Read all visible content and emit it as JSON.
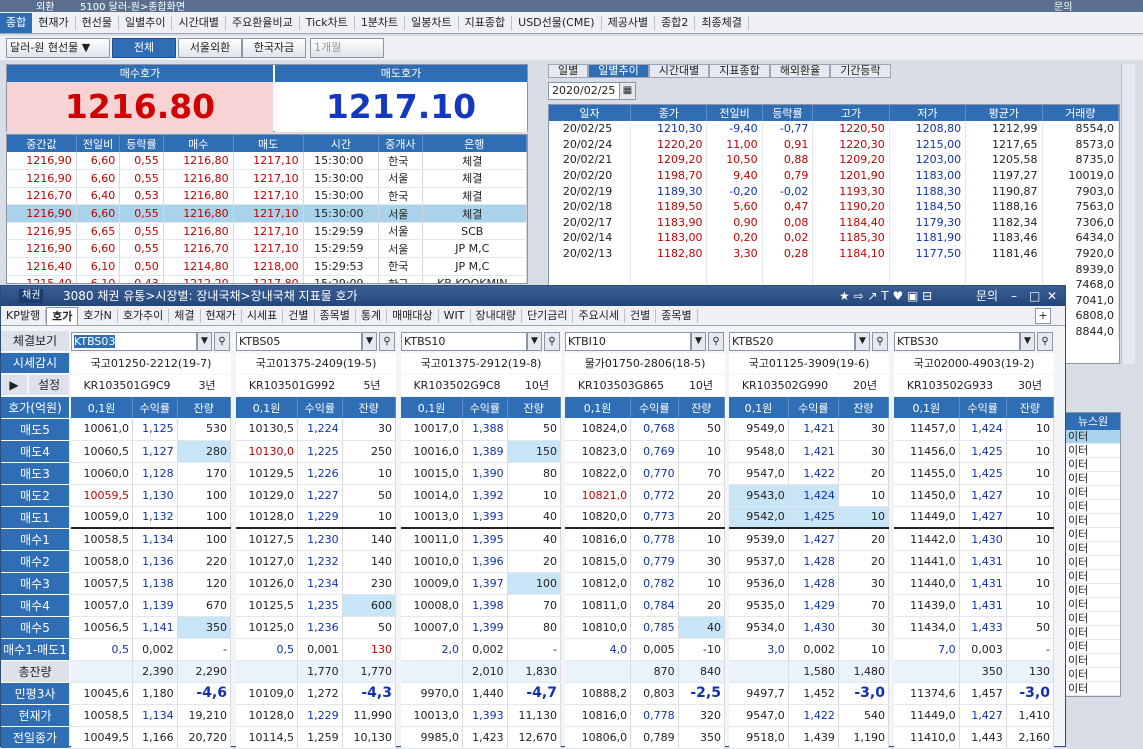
{
  "back_window": {
    "title": "5100 달러-원>종합화면",
    "title_prefix": "외환",
    "help": "문의",
    "tabs": [
      "종합",
      "현재가",
      "현선물",
      "일별추이",
      "시간대별",
      "주요환율비교",
      "Tick차트",
      "1분차트",
      "일봉차트",
      "지표종합",
      "USD선물(CME)",
      "제공사별",
      "종합2",
      "최종체결"
    ],
    "product": "달러-원 현선물",
    "filters": [
      "전체",
      "서울외환",
      "한국자금"
    ],
    "month_select": "1개월",
    "bid_label": "매수호가",
    "ask_label": "매도호가",
    "bid": "1216.80",
    "ask": "1217.10",
    "list_headers": [
      "중간값",
      "전일비",
      "등락률",
      "매수",
      "매도",
      "시간",
      "중개사",
      "은행"
    ],
    "list_rows": [
      [
        "1216,90",
        "6,60",
        "0,55",
        "1216,80",
        "1217,10",
        "15:30:00",
        "한국",
        "체결"
      ],
      [
        "1216,90",
        "6,60",
        "0,55",
        "1216,80",
        "1217,10",
        "15:30:00",
        "서울",
        "체결"
      ],
      [
        "1216,70",
        "6,40",
        "0,53",
        "1216,80",
        "1217,10",
        "15:30:00",
        "한국",
        "체결"
      ],
      [
        "1216,90",
        "6,60",
        "0,55",
        "1216,80",
        "1217,10",
        "15:30:00",
        "서울",
        "체결"
      ],
      [
        "1216,95",
        "6,65",
        "0,55",
        "1216,80",
        "1217,10",
        "15:29:59",
        "서울",
        "SCB"
      ],
      [
        "1216,90",
        "6,60",
        "0,55",
        "1216,70",
        "1217,10",
        "15:29:59",
        "서울",
        "JP M,C"
      ],
      [
        "1216,40",
        "6,10",
        "0,50",
        "1214,80",
        "1218,00",
        "15:29:53",
        "한국",
        "JP M,C"
      ],
      [
        "1215,40",
        "6,10",
        "0,43",
        "1212,20",
        "1217,80",
        "15:29:09",
        "한국",
        "KB KOOKMIN"
      ]
    ],
    "right_tabs": [
      "일별",
      "일별추이",
      "시간대별",
      "지표종합",
      "해외환율",
      "기간등락"
    ],
    "date": "2020/02/25",
    "daily_headers": [
      "일자",
      "종가",
      "전일비",
      "등락률",
      "고가",
      "저가",
      "평균가",
      "거래량"
    ],
    "daily_rows": [
      [
        "20/02/25",
        "1210,30",
        "-9,40",
        "-0,77",
        "1220,50",
        "1208,80",
        "1212,99",
        "8554,0"
      ],
      [
        "20/02/24",
        "1220,20",
        "11,00",
        "0,91",
        "1220,30",
        "1215,00",
        "1217,65",
        "8573,0"
      ],
      [
        "20/02/21",
        "1209,20",
        "10,50",
        "0,88",
        "1209,20",
        "1203,00",
        "1205,58",
        "8735,0"
      ],
      [
        "20/02/20",
        "1198,70",
        "9,40",
        "0,79",
        "1201,90",
        "1183,00",
        "1197,27",
        "10019,0"
      ],
      [
        "20/02/19",
        "1189,30",
        "-0,20",
        "-0,02",
        "1193,30",
        "1188,30",
        "1190,87",
        "7903,0"
      ],
      [
        "20/02/18",
        "1189,50",
        "5,60",
        "0,47",
        "1190,20",
        "1184,50",
        "1188,16",
        "7563,0"
      ],
      [
        "20/02/17",
        "1183,90",
        "0,90",
        "0,08",
        "1184,40",
        "1179,30",
        "1182,34",
        "7306,0"
      ],
      [
        "20/02/14",
        "1183,00",
        "0,20",
        "0,02",
        "1185,30",
        "1181,90",
        "1183,46",
        "6434,0"
      ],
      [
        "20/02/13",
        "1182,80",
        "3,30",
        "0,28",
        "1184,10",
        "1177,50",
        "1181,46",
        "7920,0"
      ],
      [
        "",
        "",
        "",
        "",
        "",
        "",
        "",
        "8939,0"
      ],
      [
        "",
        "",
        "",
        "",
        "",
        "",
        "",
        "7468,0"
      ],
      [
        "",
        "",
        "",
        "",
        "",
        "",
        "",
        "7041,0"
      ],
      [
        "",
        "",
        "",
        "",
        "",
        "",
        "",
        "6808,0"
      ],
      [
        "",
        "",
        "",
        "",
        "",
        "",
        "",
        "8844,0"
      ]
    ],
    "news_header": "뉴스원",
    "news_item": "이터"
  },
  "front_window": {
    "title_icon": "채권",
    "title": "3080 채권 유통>시장별: 장내국채>장내국채 지표물 호가",
    "help": "문의",
    "tabs": [
      "KP발행",
      "호가",
      "호가N",
      "호가추이",
      "체결",
      "현재가",
      "시세표",
      "건별",
      "종목별",
      "통계",
      "매매대상",
      "WIT",
      "장내대량",
      "단기금리",
      "주요시세",
      "건별",
      "종목별"
    ],
    "left_labels": [
      "체결보기",
      "시세감시",
      "설정",
      "호가(억원)",
      "매도5",
      "매도4",
      "매도3",
      "매도2",
      "매도1",
      "매수1",
      "매수2",
      "매수3",
      "매수4",
      "매수5",
      "매수1-매도1",
      "총잔량",
      "민평3사",
      "현재가",
      "전일종가"
    ],
    "col_headers": [
      "0,1원",
      "수익률",
      "잔량"
    ],
    "bonds": [
      {
        "code": "KTBS03",
        "name": "국고01250-2212(19-7)",
        "isin": "KR103501G9C9",
        "term": "3년",
        "rows": [
          [
            "10061,0",
            "1,125",
            "530"
          ],
          [
            "10060,5",
            "1,127",
            "280"
          ],
          [
            "10060,0",
            "1,128",
            "170"
          ],
          [
            "10059,5",
            "1,130",
            "100"
          ],
          [
            "10059,0",
            "1,132",
            "100"
          ],
          [
            "10058,5",
            "1,134",
            "100"
          ],
          [
            "10058,0",
            "1,136",
            "220"
          ],
          [
            "10057,5",
            "1,138",
            "120"
          ],
          [
            "10057,0",
            "1,139",
            "670"
          ],
          [
            "10056,5",
            "1,141",
            "350"
          ],
          [
            "0,5",
            "0,002",
            "-"
          ]
        ],
        "tot": [
          "2,390",
          "2,290"
        ],
        "mp": [
          "10045,6",
          "1,180",
          "-4,6"
        ],
        "cur": [
          "10058,5",
          "1,134",
          "19,210"
        ],
        "prev": [
          "10049,5",
          "1,166",
          "20,720"
        ]
      },
      {
        "code": "KTBS05",
        "name": "국고01375-2409(19-5)",
        "isin": "KR103501G992",
        "term": "5년",
        "rows": [
          [
            "10130,5",
            "1,224",
            "30"
          ],
          [
            "10130,0",
            "1,225",
            "250"
          ],
          [
            "10129,5",
            "1,226",
            "10"
          ],
          [
            "10129,0",
            "1,227",
            "50"
          ],
          [
            "10128,0",
            "1,229",
            "10"
          ],
          [
            "10127,5",
            "1,230",
            "140"
          ],
          [
            "10127,0",
            "1,232",
            "140"
          ],
          [
            "10126,0",
            "1,234",
            "230"
          ],
          [
            "10125,5",
            "1,235",
            "600"
          ],
          [
            "10125,0",
            "1,236",
            "50"
          ],
          [
            "0,5",
            "0,001",
            "130"
          ]
        ],
        "tot": [
          "1,770",
          "1,770"
        ],
        "mp": [
          "10109,0",
          "1,272",
          "-4,3"
        ],
        "cur": [
          "10128,0",
          "1,229",
          "11,990"
        ],
        "prev": [
          "10114,5",
          "1,259",
          "10,130"
        ]
      },
      {
        "code": "KTBS10",
        "name": "국고01375-2912(19-8)",
        "isin": "KR103502G9C8",
        "term": "10년",
        "rows": [
          [
            "10017,0",
            "1,388",
            "50"
          ],
          [
            "10016,0",
            "1,389",
            "150"
          ],
          [
            "10015,0",
            "1,390",
            "80"
          ],
          [
            "10014,0",
            "1,392",
            "10"
          ],
          [
            "10013,0",
            "1,393",
            "40"
          ],
          [
            "10011,0",
            "1,395",
            "40"
          ],
          [
            "10010,0",
            "1,396",
            "20"
          ],
          [
            "10009,0",
            "1,397",
            "100"
          ],
          [
            "10008,0",
            "1,398",
            "70"
          ],
          [
            "10007,0",
            "1,399",
            "80"
          ],
          [
            "2,0",
            "0,002",
            "-"
          ]
        ],
        "tot": [
          "2,010",
          "1,830"
        ],
        "mp": [
          "9970,0",
          "1,440",
          "-4,7"
        ],
        "cur": [
          "10013,0",
          "1,393",
          "11,130"
        ],
        "prev": [
          "9985,0",
          "1,423",
          "12,670"
        ]
      },
      {
        "code": "KTBI10",
        "name": "물가01750-2806(18-5)",
        "isin": "KR103503G865",
        "term": "10년",
        "rows": [
          [
            "10824,0",
            "0,768",
            "50"
          ],
          [
            "10823,0",
            "0,769",
            "10"
          ],
          [
            "10822,0",
            "0,770",
            "70"
          ],
          [
            "10821,0",
            "0,772",
            "20"
          ],
          [
            "10820,0",
            "0,773",
            "20"
          ],
          [
            "10816,0",
            "0,778",
            "10"
          ],
          [
            "10815,0",
            "0,779",
            "30"
          ],
          [
            "10812,0",
            "0,782",
            "10"
          ],
          [
            "10811,0",
            "0,784",
            "20"
          ],
          [
            "10810,0",
            "0,785",
            "40"
          ],
          [
            "4,0",
            "0,005",
            "-10"
          ]
        ],
        "tot": [
          "870",
          "840"
        ],
        "mp": [
          "10888,2",
          "0,803",
          "-2,5"
        ],
        "cur": [
          "10816,0",
          "0,778",
          "320"
        ],
        "prev": [
          "10806,0",
          "0,789",
          "350"
        ]
      },
      {
        "code": "KTBS20",
        "name": "국고01125-3909(19-6)",
        "isin": "KR103502G990",
        "term": "20년",
        "rows": [
          [
            "9549,0",
            "1,421",
            "30"
          ],
          [
            "9548,0",
            "1,421",
            "30"
          ],
          [
            "9547,0",
            "1,422",
            "20"
          ],
          [
            "9543,0",
            "1,424",
            "10"
          ],
          [
            "9542,0",
            "1,425",
            "10"
          ],
          [
            "9539,0",
            "1,427",
            "20"
          ],
          [
            "9537,0",
            "1,428",
            "20"
          ],
          [
            "9536,0",
            "1,428",
            "30"
          ],
          [
            "9535,0",
            "1,429",
            "70"
          ],
          [
            "9534,0",
            "1,430",
            "30"
          ],
          [
            "3,0",
            "0,002",
            "10"
          ]
        ],
        "tot": [
          "1,580",
          "1,480"
        ],
        "mp": [
          "9497,7",
          "1,452",
          "-3,0"
        ],
        "cur": [
          "9547,0",
          "1,422",
          "540"
        ],
        "prev": [
          "9518,0",
          "1,439",
          "1,190"
        ]
      },
      {
        "code": "KTBS30",
        "name": "국고02000-4903(19-2)",
        "isin": "KR103502G933",
        "term": "30년",
        "rows": [
          [
            "11457,0",
            "1,424",
            "10"
          ],
          [
            "11456,0",
            "1,425",
            "10"
          ],
          [
            "11455,0",
            "1,425",
            "10"
          ],
          [
            "11450,0",
            "1,427",
            "10"
          ],
          [
            "11449,0",
            "1,427",
            "10"
          ],
          [
            "11442,0",
            "1,430",
            "10"
          ],
          [
            "11441,0",
            "1,431",
            "10"
          ],
          [
            "11440,0",
            "1,431",
            "10"
          ],
          [
            "11439,0",
            "1,431",
            "10"
          ],
          [
            "11434,0",
            "1,433",
            "50"
          ],
          [
            "7,0",
            "0,003",
            "-"
          ]
        ],
        "tot": [
          "350",
          "130"
        ],
        "mp": [
          "11374,6",
          "1,457",
          "-3,0"
        ],
        "cur": [
          "11449,0",
          "1,427",
          "1,410"
        ],
        "prev": [
          "11410,0",
          "1,443",
          "2,160"
        ]
      }
    ]
  }
}
